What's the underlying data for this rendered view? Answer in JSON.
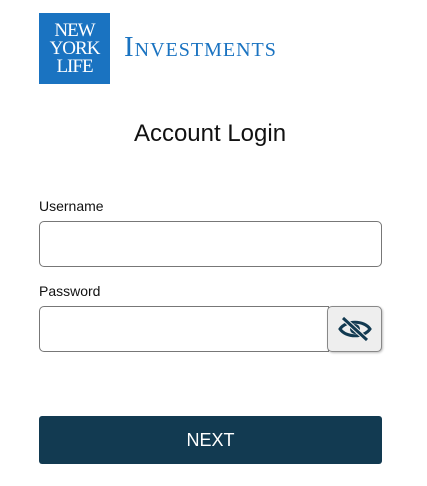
{
  "brand": {
    "logo_lines": [
      "NEW",
      "YORK",
      "LIFE"
    ],
    "name": "Investments",
    "color": "#1a73c1"
  },
  "page": {
    "title": "Account Login"
  },
  "form": {
    "username_label": "Username",
    "username_value": "",
    "password_label": "Password",
    "password_value": "",
    "toggle_icon": "eye-slash-icon",
    "submit_label": "NEXT",
    "submit_color": "#123a51"
  }
}
